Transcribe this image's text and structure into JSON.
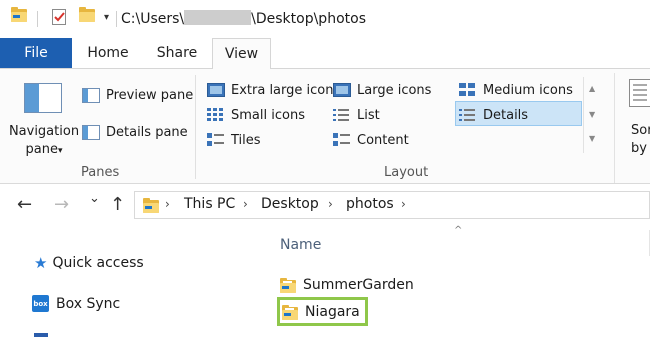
{
  "window": {
    "title_prefix": "C:\\Users\\",
    "title_suffix": "\\Desktop\\photos",
    "quick_access_dropdown": "▾"
  },
  "ribbon": {
    "tabs": {
      "file": "File",
      "home": "Home",
      "share": "Share",
      "view": "View"
    },
    "active_tab": "View",
    "panes": {
      "navigation_pane_line1": "Navigation",
      "navigation_pane_line2": "pane",
      "navigation_pane_caret": "▾",
      "preview_pane": "Preview pane",
      "details_pane": "Details pane",
      "group_label": "Panes"
    },
    "layout": {
      "extra_large_icons": "Extra large icons",
      "large_icons": "Large icons",
      "medium_icons": "Medium icons",
      "small_icons": "Small icons",
      "list": "List",
      "details": "Details",
      "tiles": "Tiles",
      "content": "Content",
      "group_label": "Layout",
      "selected": "Details"
    },
    "sort": {
      "line1": "Sor",
      "line2": "by"
    }
  },
  "address": {
    "back_icon": "←",
    "forward_icon": "→",
    "recent_icon": "⌄",
    "up_icon": "↑",
    "crumbs": [
      "This PC",
      "Desktop",
      "photos"
    ],
    "crumb_separator": "›"
  },
  "navigation_pane": {
    "items": [
      {
        "label": "Quick access",
        "icon": "star-icon"
      },
      {
        "label": "Box Sync",
        "icon": "box-icon"
      }
    ],
    "box_logo_text": "box"
  },
  "file_list": {
    "column_name": "Name",
    "sort_indicator": "^",
    "items": [
      {
        "name": "SummerGarden",
        "icon": "folder-icon"
      },
      {
        "name": "Niagara",
        "icon": "folder-icon",
        "highlighted": true
      }
    ]
  },
  "colors": {
    "file_tab": "#1d5fb1",
    "selected_view": "#cce4f7",
    "highlight_border": "#8fc74a",
    "folder": "#f8d775"
  }
}
